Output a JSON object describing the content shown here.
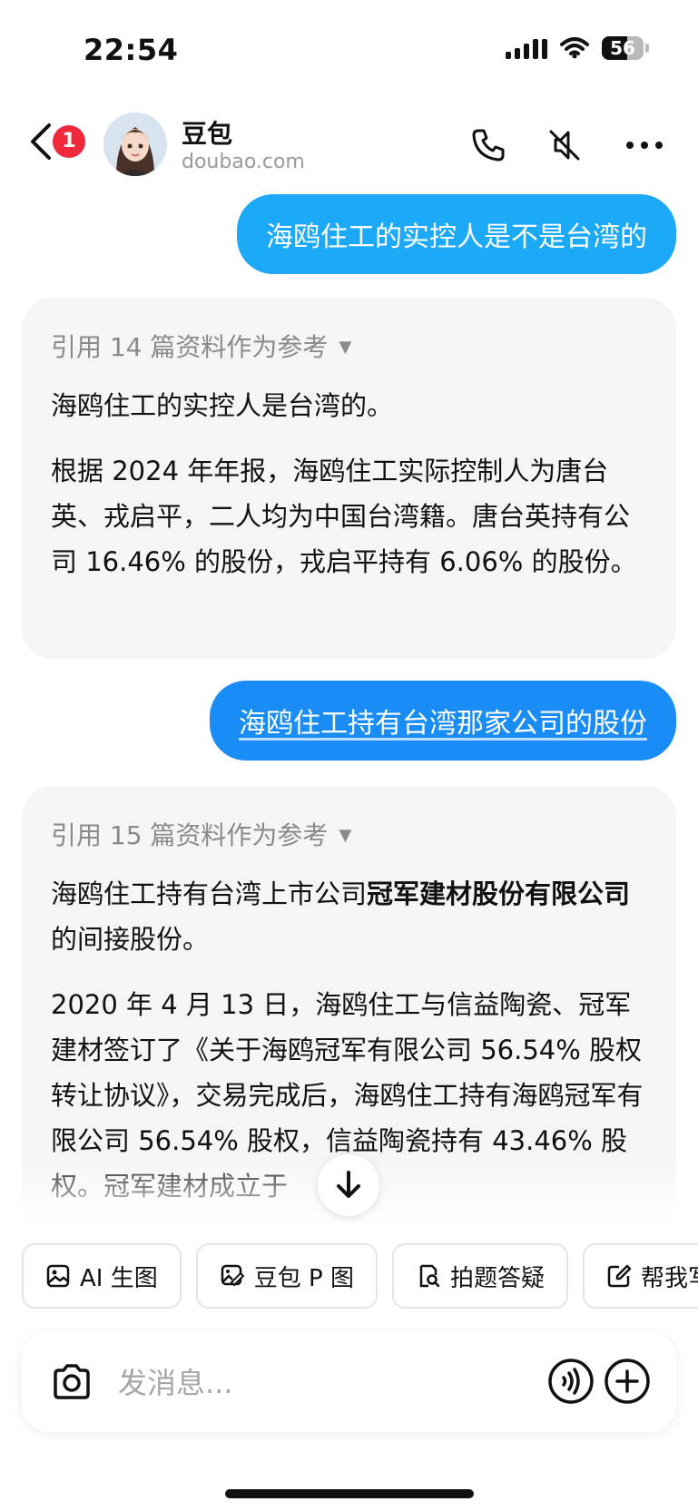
{
  "status": {
    "time": "22:54",
    "battery": "56"
  },
  "header": {
    "unread_count": "1",
    "bot_name": "豆包",
    "domain": "doubao.com"
  },
  "messages": [
    {
      "role": "user",
      "text": "海鸥住工的实控人是不是台湾的"
    },
    {
      "role": "bot",
      "reference": "引用 14 篇资料作为参考",
      "paragraphs": [
        "海鸥住工的实控人是台湾的。",
        "根据 2024 年年报，海鸥住工实际控制人为唐台英、戎启平，二人均为中国台湾籍。唐台英持有公司 16.46% 的股份，戎启平持有 6.06% 的股份。"
      ]
    },
    {
      "role": "user",
      "text": "海鸥住工持有台湾那家公司的股份"
    },
    {
      "role": "bot",
      "reference": "引用 15 篇资料作为参考",
      "p1_pre": "海鸥住工持有台湾上市公司",
      "p1_bold": "冠军建材股份有限公司",
      "p1_post": "的间接股份。",
      "p2": "2020 年 4 月 13 日，海鸥住工与信益陶瓷、冠军建材签订了《关于海鸥冠军有限公司 56.54% 股权转让协议》，交易完成后，海鸥住工持有海鸥冠军有限公司 56.54% 股权，信益陶瓷持有 43.46% 股权。冠军建材成立于"
    }
  ],
  "quick_actions": [
    "AI 生图",
    "豆包 P 图",
    "拍题答疑",
    "帮我写"
  ],
  "input": {
    "placeholder": "发消息..."
  }
}
